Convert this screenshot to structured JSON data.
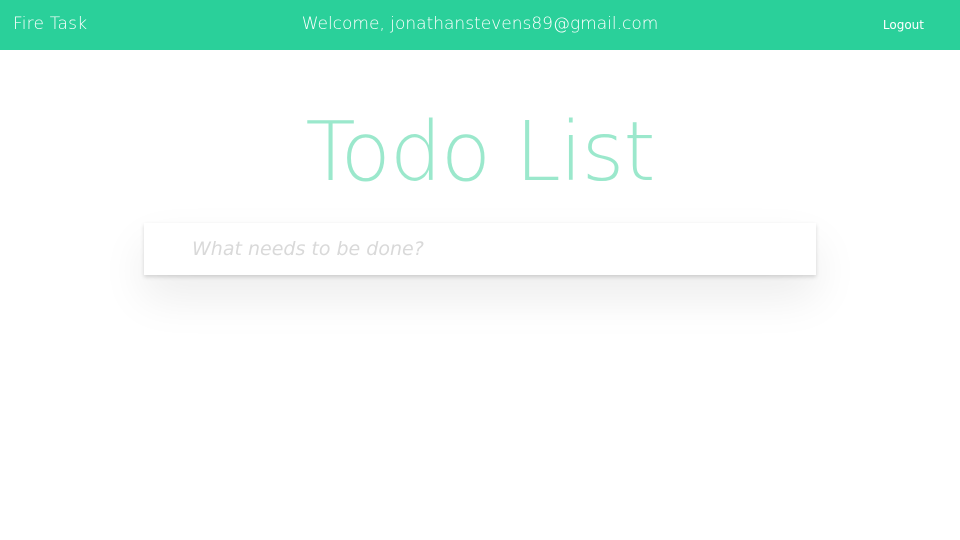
{
  "navbar": {
    "brand": "Fire Task",
    "welcome": "Welcome, jonathanstevens89@gmail.com",
    "logout_label": "Logout",
    "background_color": "#2ad09a"
  },
  "main": {
    "title": "Todo List",
    "title_color": "#9be8cc",
    "new_todo": {
      "value": "",
      "placeholder": "What needs to be done?"
    }
  }
}
